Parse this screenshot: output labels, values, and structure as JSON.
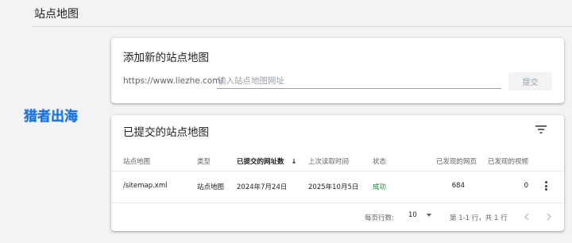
{
  "page": {
    "title": "站点地图"
  },
  "watermark": {
    "text": "猎者出海"
  },
  "add_sitemap": {
    "title": "添加新的站点地图",
    "url_prefix": "https://www.liezhe.com/",
    "input_placeholder": "输入站点地图网址",
    "input_value": "",
    "submit_label": "提交"
  },
  "submitted": {
    "title": "已提交的站点地图",
    "filter_icon": "filter-list-icon",
    "columns": {
      "sitemap": "站点地图",
      "type": "类型",
      "submitted_date": "已提交的网址数",
      "last_read": "上次读取时间",
      "status": "状态",
      "pages_found": "已发现的网页",
      "videos_found": "已发现的视频"
    },
    "sort_indicator": "↓",
    "rows": [
      {
        "sitemap": "/sitemap.xml",
        "type": "站点地图",
        "submitted_date": "2024年7月24日",
        "last_read": "2025年10月5日",
        "status": "成功",
        "pages_found": "684",
        "videos_found": "0"
      }
    ],
    "footer": {
      "rows_per_page_label": "每页行数:",
      "rows_per_page_value": "10",
      "range_text": "第 1-1 行，共 1 行"
    }
  },
  "colors": {
    "accent": "#1a73e8",
    "success": "#188038",
    "background": "#f1f3f4"
  }
}
